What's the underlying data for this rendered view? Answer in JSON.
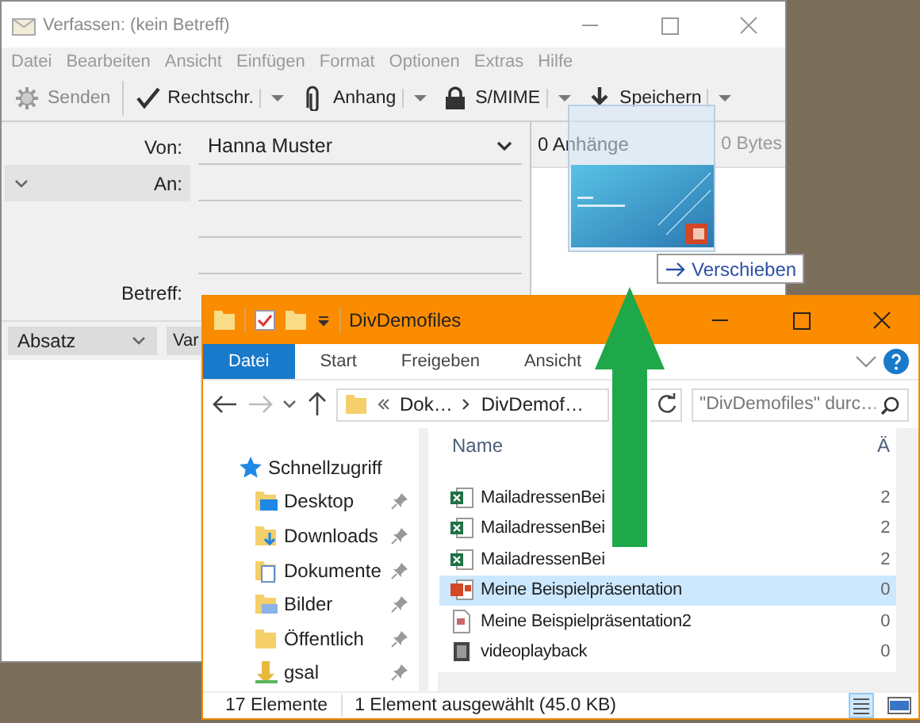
{
  "compose_window": {
    "title": "Verfassen: (kein Betreff)",
    "menu": [
      "Datei",
      "Bearbeiten",
      "Ansicht",
      "Einfügen",
      "Format",
      "Optionen",
      "Extras",
      "Hilfe"
    ],
    "toolbar": [
      {
        "kind": "send",
        "label": "Senden",
        "disabled": true,
        "dropdown": false
      },
      {
        "kind": "spell",
        "label": "Rechtschr.",
        "disabled": false,
        "dropdown": true
      },
      {
        "kind": "attach",
        "label": "Anhang",
        "disabled": false,
        "dropdown": true
      },
      {
        "kind": "lock",
        "label": "S/MIME",
        "disabled": false,
        "dropdown": true
      },
      {
        "kind": "save",
        "label": "Speichern",
        "disabled": false,
        "dropdown": true
      }
    ],
    "from": {
      "label": "Von:",
      "value": "Hanna Muster"
    },
    "to": {
      "label": "An:"
    },
    "subject": {
      "label": "Betreff:"
    },
    "attachments": {
      "title": "0 Anhänge",
      "size": "0 Bytes"
    },
    "format_bar": {
      "paragraph": "Absatz",
      "font": "Var"
    }
  },
  "drag": {
    "tooltip": "Verschieben"
  },
  "explorer": {
    "title": "DivDemofiles",
    "tabs": [
      {
        "label": "Datei",
        "selected": true
      },
      {
        "label": "Start",
        "selected": false
      },
      {
        "label": "Freigeben",
        "selected": false
      },
      {
        "label": "Ansicht",
        "selected": false
      }
    ],
    "address": [
      "Dok…",
      "DivDemof…"
    ],
    "search": {
      "placeholder": "\"DivDemofiles\" durc…"
    },
    "nav": [
      {
        "kind": "star",
        "label": "Schnellzugriff",
        "pinned": false
      },
      {
        "kind": "desktop",
        "label": "Desktop",
        "pinned": true
      },
      {
        "kind": "downloads",
        "label": "Downloads",
        "pinned": true
      },
      {
        "kind": "documents",
        "label": "Dokumente",
        "pinned": true
      },
      {
        "kind": "pictures",
        "label": "Bilder",
        "pinned": true
      },
      {
        "kind": "folder",
        "label": "Öffentlich",
        "pinned": true
      },
      {
        "kind": "user",
        "label": "gsal",
        "pinned": true
      }
    ],
    "columns": [
      "Name",
      "Ä"
    ],
    "files": [
      {
        "kind": "excel",
        "name": "MailadressenBei",
        "date": "2",
        "selected": false
      },
      {
        "kind": "excel",
        "name": "MailadressenBei",
        "date": "2",
        "selected": false
      },
      {
        "kind": "excel",
        "name": "MailadressenBei",
        "date": "2",
        "selected": false
      },
      {
        "kind": "ppt",
        "name": "Meine Beispielpräsentation",
        "date": "0",
        "selected": true
      },
      {
        "kind": "pptx",
        "name": "Meine Beispielpräsentation2",
        "date": "0",
        "selected": false
      },
      {
        "kind": "video",
        "name": "videoplayback",
        "date": "0",
        "selected": false
      }
    ],
    "status": {
      "count": "17 Elemente",
      "selection": "1 Element ausgewählt (45.0 KB)"
    }
  }
}
